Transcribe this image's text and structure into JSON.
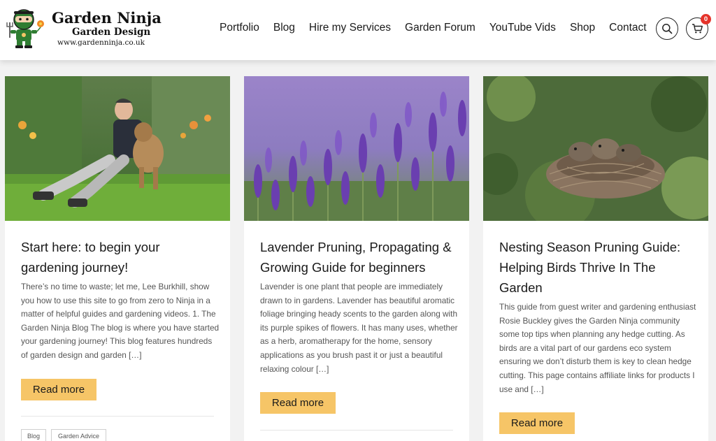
{
  "header": {
    "logo": {
      "title": "Garden Ninja",
      "subtitle": "Garden Design",
      "url": "www.gardenninja.co.uk"
    },
    "nav": [
      "Portfolio",
      "Blog",
      "Hire my Services",
      "Garden Forum",
      "YouTube Vids",
      "Shop",
      "Contact"
    ],
    "cart_count": "0"
  },
  "posts": [
    {
      "title": "Start here: to begin your gardening journey!",
      "excerpt": "There’s no time to waste; let me, Lee Burkhill, show you how to use this site to go from zero to Ninja in a matter of helpful guides and gardening videos. 1. The Garden Ninja Blog The blog is where you have started your gardening journey! This blog features hundreds of garden design and garden […]",
      "button": "Read more",
      "tags": [
        "Blog",
        "Garden Advice"
      ]
    },
    {
      "title": "Lavender Pruning, Propagating & Growing Guide for beginners",
      "excerpt": "Lavender is one plant that people are immediately drawn to in gardens. Lavender has beautiful aromatic foliage bringing heady scents to the garden along with its purple spikes of flowers. It has many uses, whether as a herb, aromatherapy for the home, sensory applications as you brush past it or just a beautiful relaxing colour […]",
      "button": "Read more"
    },
    {
      "title": "Nesting Season Pruning Guide: Helping Birds Thrive In The Garden",
      "excerpt": "This guide from guest writer and gardening enthusiast Rosie Buckley gives the Garden Ninja community some top tips when planning any hedge cutting. As birds are a vital part of our gardens eco system ensuring we don’t disturb them is key to clean hedge cutting. This page contains affiliate links for products I use and […]",
      "button": "Read more"
    }
  ],
  "colors": {
    "button": "#f6c567",
    "badge": "#e5332a",
    "background": "#f2f2f2"
  }
}
